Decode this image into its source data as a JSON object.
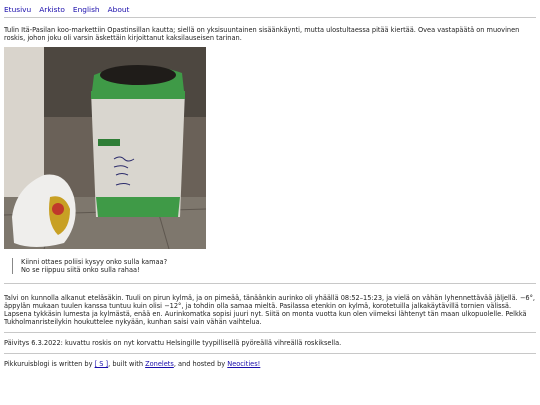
{
  "nav": {
    "links": [
      "Etusivu",
      "Arkisto",
      "English",
      "About"
    ]
  },
  "post": {
    "intro": "Tulin Itä-Pasilan koo-markettiin Opastinsillan kautta; siellä on yksisuuntainen sisäänkäynti, mutta ulostultaessa pitää kiertää. Ovea vastapäätä on muovinen roskis, johon joku oli varsin äskettäin kirjoittanut kaksilauseisen tarinan.",
    "photo_alt": "Roskis",
    "quote_line1": "Kiinni ottaes poliisi kysyy onko sulla kamaa?",
    "quote_line2": "No se riippuu siitä onko sulla rahaa!",
    "weather": "Talvi on kunnolla alkanut eteläsäkin. Tuuli on pirun kylmä, ja on pimeää, tänäänkin aurinko oli yhäällä 08:52–15:23, ja vielä on vähän lyhennettävää jäljellä. −6°, äppylän mukaan tuulen kanssa tuntuu kuin olisi −12°, ja tohdin olla samaa mieltä. Pasilassa etenkin on kylmä, korotetuilla jalkakäytävillä tornien välissä. Lapsena tykkäsin lumesta ja kylmästä, enää en. Aurinkomatka sopisi juuri nyt. Siitä on monta vuotta kun olen viimeksi lähtenyt tän maan ulkopuolelle. Pelkkä Tukholmanristeilykin houkuttelee nykyään, kunhan saisi vain vähän vaihtelua.",
    "update": "Päivitys 6.3.2022: kuvattu roskis on nyt korvattu Helsingille tyypillisellä pyöreällä vihreällä roskiksella."
  },
  "footer": {
    "prefix": "Pikkuruisblogi is written by ",
    "author": "[ S ]",
    "middle": ", built with ",
    "zonelets": "Zonelets",
    "hosted": ", and hosted by ",
    "neocities": "Neocities!"
  },
  "colors": {
    "link": "#1a0dab",
    "bin_green": "#3f9a47",
    "bin_body": "#d9d6cf"
  }
}
